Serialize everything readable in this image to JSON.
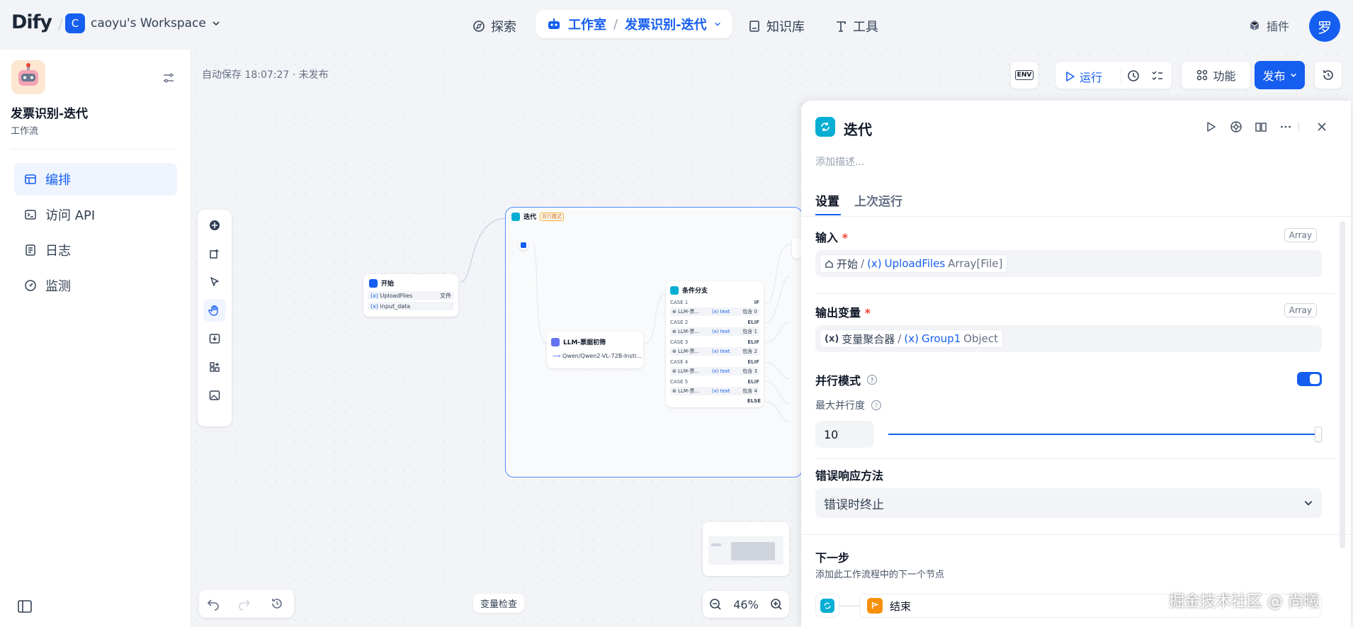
{
  "header": {
    "logo": "Dify",
    "workspace_initial": "C",
    "workspace_name": "caoyu's Workspace",
    "nav": {
      "explore": "探索",
      "studio": "工作室",
      "app_name": "发票识别-迭代",
      "knowledge": "知识库",
      "tools": "工具"
    },
    "plugins": "插件",
    "avatar": "罗"
  },
  "sidebar": {
    "app_name": "发票识别-迭代",
    "app_type": "工作流",
    "items": [
      {
        "label": "编排",
        "icon": "orchestrate-icon",
        "active": true
      },
      {
        "label": "访问 API",
        "icon": "terminal-icon"
      },
      {
        "label": "日志",
        "icon": "log-icon"
      },
      {
        "label": "监测",
        "icon": "monitor-icon"
      }
    ]
  },
  "canvas": {
    "autosave": "自动保存 18:07:27 · 未发布",
    "toolbar": {
      "env": "ENV",
      "run": "运行",
      "features": "功能",
      "publish": "发布"
    },
    "zoom": "46%",
    "var_inspect": "变量检查",
    "nodes": {
      "start": {
        "title": "开始",
        "vars": [
          "UploadFiles",
          "input_data"
        ],
        "var_tag": "文件"
      },
      "iteration": {
        "title": "迭代",
        "badge": "并行模式"
      },
      "llm": {
        "title": "LLM-票据初筛",
        "model": "Qwen/Qwen2-VL-72B-Instr..."
      },
      "ifelse": {
        "title": "条件分支",
        "cases": [
          "CASE 1",
          "CASE 2",
          "CASE 3",
          "CASE 4",
          "CASE 5"
        ],
        "branch_labels": [
          "IF",
          "ELIF",
          "ELIF",
          "ELIF",
          "ELIF"
        ],
        "cond_var": "LLM-票...",
        "cond_type": "text",
        "cond_vals": [
          "包含 0",
          "包含 1",
          "包含 2",
          "包含 3",
          "包含 4"
        ],
        "else": "ELSE"
      }
    }
  },
  "panel": {
    "title": "迭代",
    "desc_placeholder": "添加描述...",
    "tabs": {
      "settings": "设置",
      "last_run": "上次运行"
    },
    "input": {
      "label": "输入",
      "type": "Array",
      "node": "开始",
      "var": "UploadFiles",
      "var_type": "Array[File]"
    },
    "output": {
      "label": "输出变量",
      "type": "Array",
      "node": "变量聚合器",
      "var": "Group1",
      "var_type": "Object"
    },
    "parallel": {
      "label": "并行模式",
      "enabled": true
    },
    "max_parallel": {
      "label": "最大并行度",
      "value": "10",
      "level": 1.0
    },
    "error": {
      "label": "错误响应方法",
      "value": "错误时终止"
    },
    "next": {
      "label": "下一步",
      "desc": "添加此工作流程中的下一个节点",
      "node": "结束"
    }
  },
  "watermark": "掘金技术社区 @ 尚曦",
  "colors": {
    "accent": "#155eef",
    "iteration": "#06aed4",
    "end": "#f79009"
  }
}
